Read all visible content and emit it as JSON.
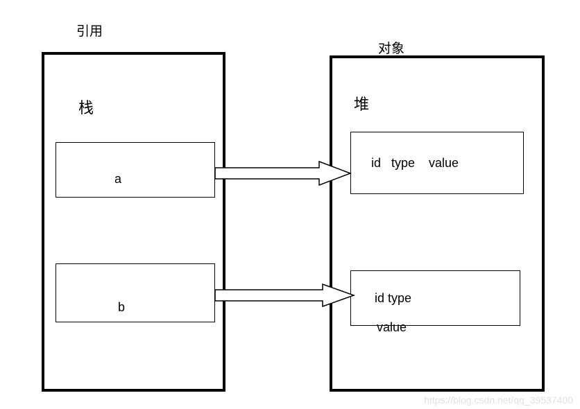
{
  "labels": {
    "reference": "引用",
    "object": "对象",
    "stack": "栈",
    "heap": "堆"
  },
  "stack_items": {
    "item1": "a",
    "item2": "b"
  },
  "heap_items": {
    "item1_line1": "id   type    value",
    "item2_line1": "id type",
    "item2_line2": "value"
  },
  "watermark": "https://blog.csdn.net/qq_39537400"
}
